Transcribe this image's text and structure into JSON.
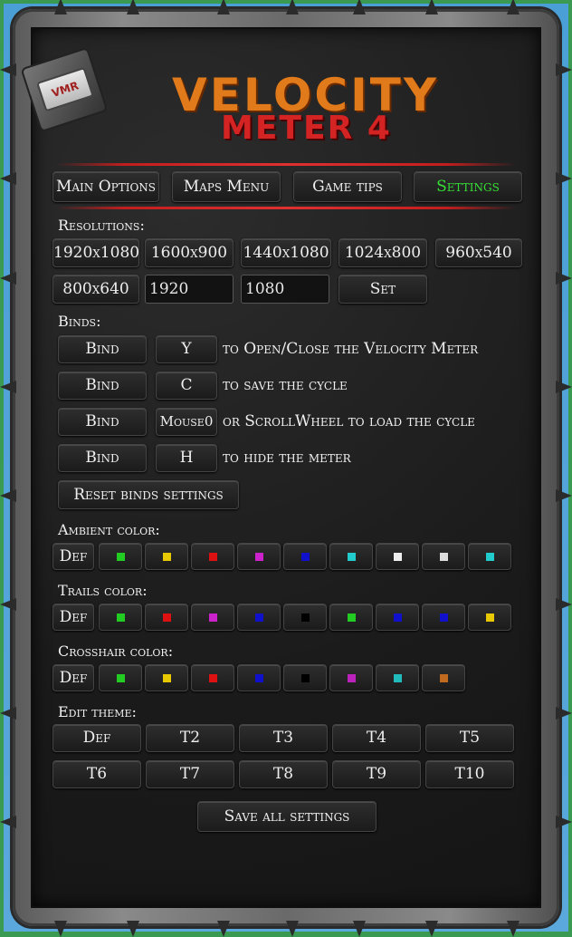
{
  "title": {
    "line1": "VELOCITY",
    "line2": "METER 4",
    "badge": "VMR"
  },
  "tabs": [
    {
      "label": "Main Options",
      "active": false
    },
    {
      "label": "Maps Menu",
      "active": false
    },
    {
      "label": "Game tips",
      "active": false
    },
    {
      "label": "Settings",
      "active": true
    }
  ],
  "resolutions": {
    "heading": "Resolutions:",
    "presets": [
      "1920x1080",
      "1600x900",
      "1440x1080",
      "1024x800",
      "960x540",
      "800x640"
    ],
    "width_value": "1920",
    "height_value": "1080",
    "set_label": "Set"
  },
  "binds": {
    "heading": "Binds:",
    "bind_label": "Bind",
    "rows": [
      {
        "key": "Y",
        "description": "to Open/Close the Velocity Meter"
      },
      {
        "key": "C",
        "description": "to save the cycle"
      },
      {
        "key": "Mouse0",
        "description": "or ScrollWheel to load the cycle"
      },
      {
        "key": "H",
        "description": "to hide the meter"
      }
    ],
    "reset_label": "Reset binds settings"
  },
  "ambient": {
    "heading": "Ambient color:",
    "def_label": "Def",
    "colors": [
      "#22cc22",
      "#e8c800",
      "#dd1111",
      "#cc22cc",
      "#1111cc",
      "#22cccc",
      "#eeeeee",
      "#dddddd",
      "#22cccc"
    ]
  },
  "trails": {
    "heading": "Trails color:",
    "def_label": "Def",
    "colors": [
      "#22cc22",
      "#dd1111",
      "#cc22cc",
      "#1111cc",
      "#000000",
      "#22cc22",
      "#1111cc",
      "#1111cc",
      "#e8c800"
    ]
  },
  "crosshair": {
    "heading": "Crosshair color:",
    "def_label": "Def",
    "colors": [
      "#22cc22",
      "#e8c800",
      "#dd1111",
      "#1111cc",
      "#000000",
      "#bb22bb",
      "#22bbbb",
      "#c06a20"
    ]
  },
  "theme": {
    "heading": "Edit theme:",
    "buttons": [
      "Def",
      "T2",
      "T3",
      "T4",
      "T5",
      "T6",
      "T7",
      "T8",
      "T9",
      "T10"
    ]
  },
  "save_label": "Save all settings"
}
